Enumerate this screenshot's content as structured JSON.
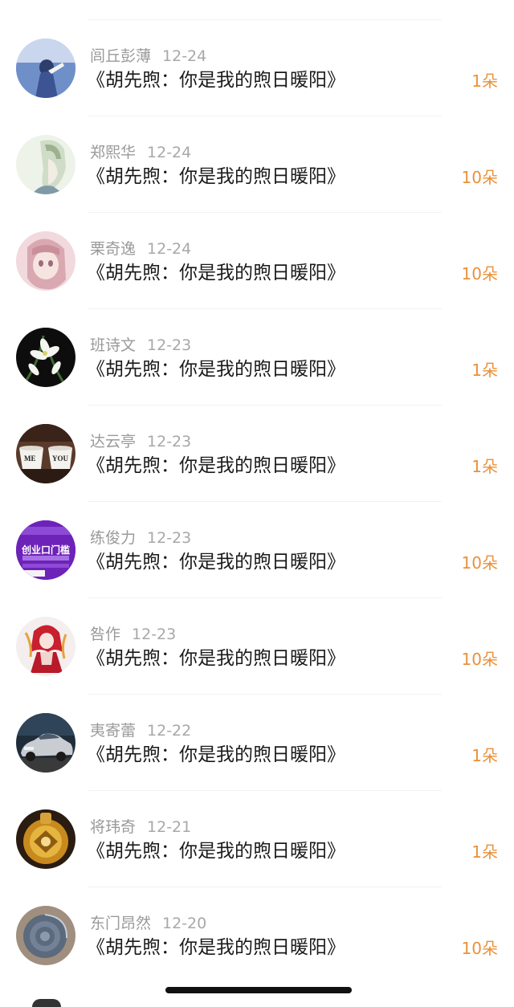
{
  "gift_list": {
    "items": [
      {
        "name": "闾丘彭薄",
        "date": "12-24",
        "title": "《胡先煦：你是我的煦日暖阳》",
        "count": "1朵",
        "avatar": "person-seaside-avatar"
      },
      {
        "name": "郑熙华",
        "date": "12-24",
        "title": "《胡先煦：你是我的煦日暖阳》",
        "count": "10朵",
        "avatar": "anime-man-avatar"
      },
      {
        "name": "栗奇逸",
        "date": "12-24",
        "title": "《胡先煦：你是我的煦日暖阳》",
        "count": "10朵",
        "avatar": "anime-girl-avatar"
      },
      {
        "name": "班诗文",
        "date": "12-23",
        "title": "《胡先煦：你是我的煦日暖阳》",
        "count": "1朵",
        "avatar": "white-flower-avatar"
      },
      {
        "name": "达云亭",
        "date": "12-23",
        "title": "《胡先煦：你是我的煦日暖阳》",
        "count": "1朵",
        "avatar": "me-you-cups-avatar"
      },
      {
        "name": "练俊力",
        "date": "12-23",
        "title": "《胡先煦：你是我的煦日暖阳》",
        "count": "10朵",
        "avatar": "business-ad-avatar",
        "avatar_text": "创业口门槛"
      },
      {
        "name": "咎作",
        "date": "12-23",
        "title": "《胡先煦：你是我的煦日暖阳》",
        "count": "10朵",
        "avatar": "red-anime-avatar"
      },
      {
        "name": "夷寄蕾",
        "date": "12-22",
        "title": "《胡先煦：你是我的煦日暖阳》",
        "count": "1朵",
        "avatar": "car-avatar"
      },
      {
        "name": "将玮奇",
        "date": "12-21",
        "title": "《胡先煦：你是我的煦日暖阳》",
        "count": "1朵",
        "avatar": "golden-ornament-avatar"
      },
      {
        "name": "东门昂然",
        "date": "12-20",
        "title": "《胡先煦：你是我的煦日暖阳》",
        "count": "10朵",
        "avatar": "snail-shell-avatar"
      }
    ]
  },
  "colors": {
    "count": "#e9913a",
    "name": "#9a9a9a",
    "title": "#1a1a1a"
  }
}
